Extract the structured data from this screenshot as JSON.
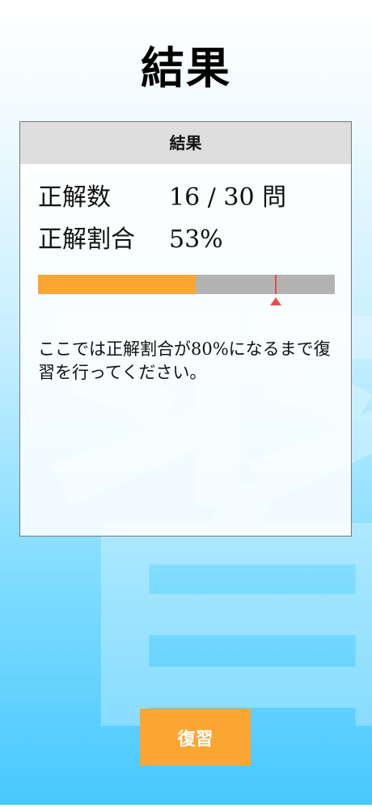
{
  "page": {
    "title": "結果",
    "background_kanji": "習"
  },
  "card": {
    "header": "結果",
    "correct_count_label": "正解数",
    "correct_count_value": "16 / 30 問",
    "correct_rate_label": "正解割合",
    "correct_rate_value": "53%",
    "progress": {
      "fraction": 0.53,
      "target_fraction": 0.8
    },
    "message": "ここでは正解割合が80%になるまで復習を行ってください。"
  },
  "button": {
    "review_label": "復習"
  },
  "colors": {
    "accent_orange": "#fba532",
    "target_red": "#e84d4d",
    "track_gray": "#b3b3b3",
    "header_gray": "#dedede"
  }
}
